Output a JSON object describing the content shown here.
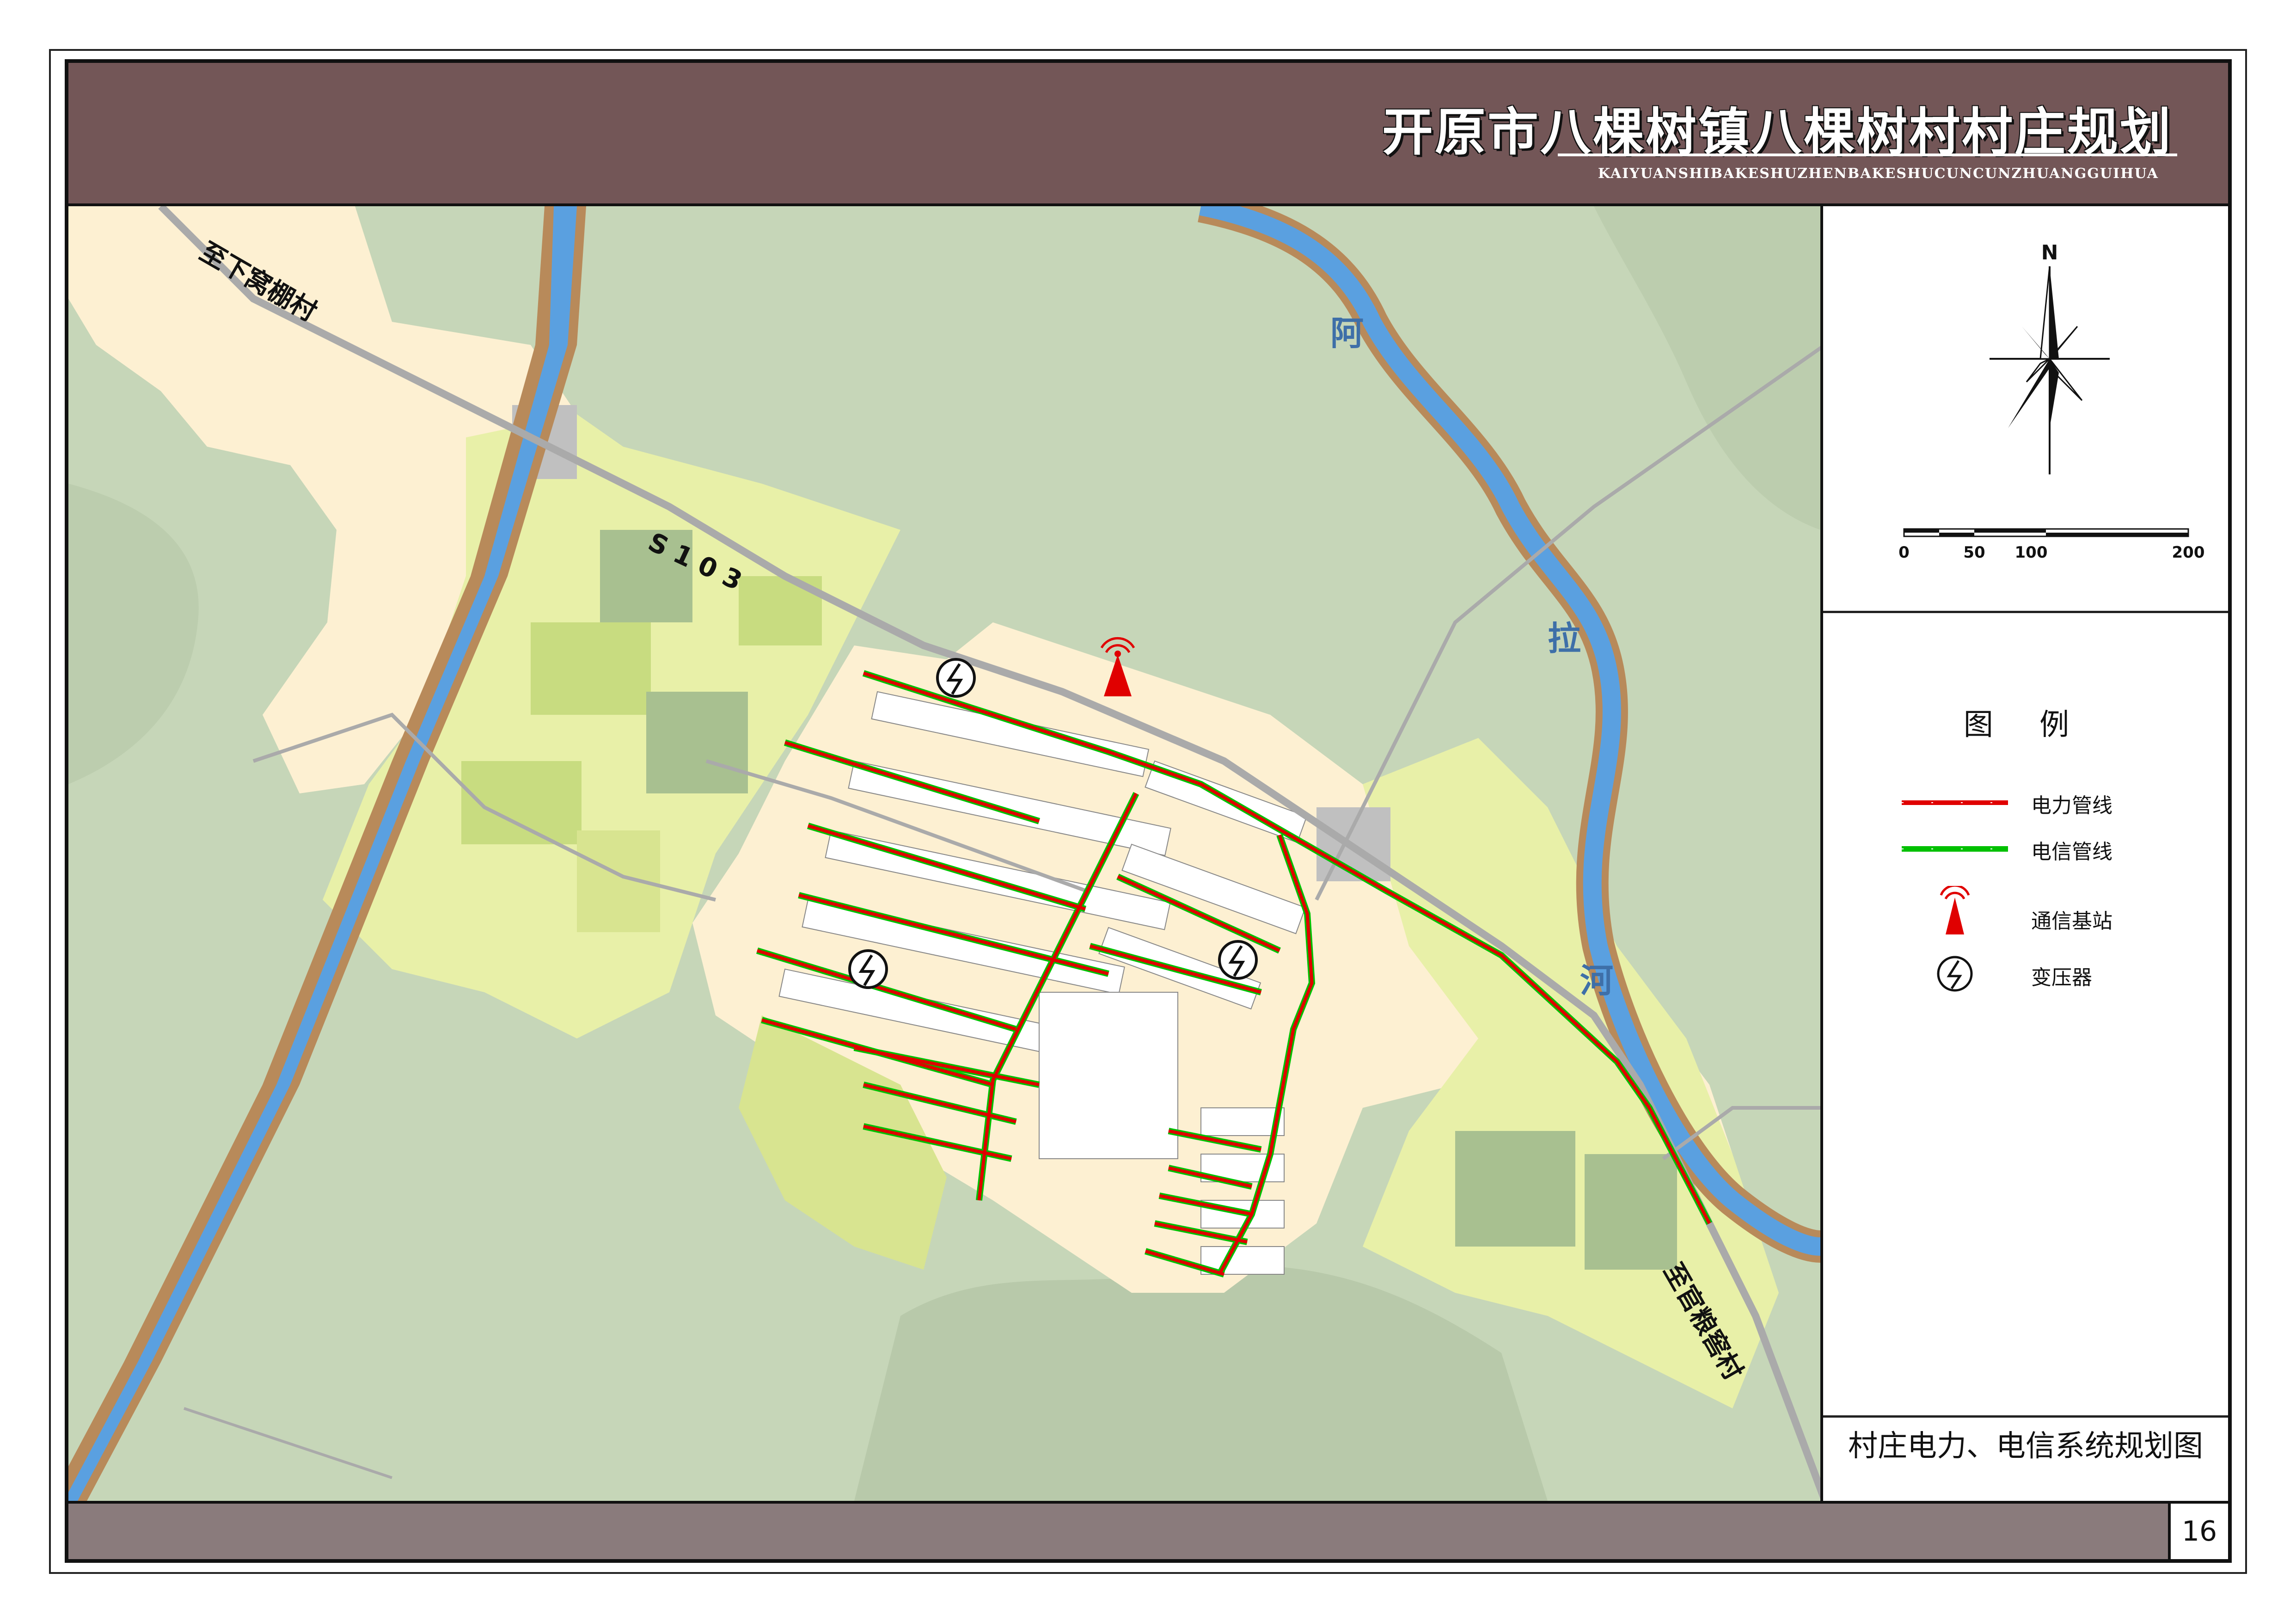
{
  "header": {
    "title": "开原市八棵树镇八棵树村村庄规划",
    "subtitle": "KAIYUANSHIBAKESHUZHENBAKESHUCUNCUNZHUANGGUIHUA"
  },
  "map": {
    "road_label": "S 1 0 3",
    "place_label_nw": "至下窝棚村",
    "place_label_se": "至官粮窖村",
    "river_chars": [
      "阿",
      "拉",
      "河"
    ]
  },
  "compass": {
    "north_label": "N",
    "scale_ticks": [
      "0",
      "50",
      "100",
      "200"
    ]
  },
  "legend": {
    "title": "图 例",
    "items": [
      {
        "label": "电力管线",
        "icon": "power-line-icon",
        "color": "#e00000"
      },
      {
        "label": "电信管线",
        "icon": "telecom-line-icon",
        "color": "#00c000"
      },
      {
        "label": "通信基站",
        "icon": "cell-tower-icon",
        "color": "#e00000"
      },
      {
        "label": "变压器",
        "icon": "transformer-icon",
        "color": "#111111"
      }
    ]
  },
  "drawing_name": "村庄电力、电信系统规划图",
  "page_number": "16",
  "colors": {
    "header": "#735657",
    "footer": "#8a7b7c",
    "map_ground": "#c6d6b8",
    "river": "#5aa0e0",
    "river_bank": "#b88a5a",
    "residential": "#fdf0d2",
    "field_light": "#e8f0a8",
    "field_mid": "#c8dc80",
    "field_dark": "#a8c090"
  }
}
